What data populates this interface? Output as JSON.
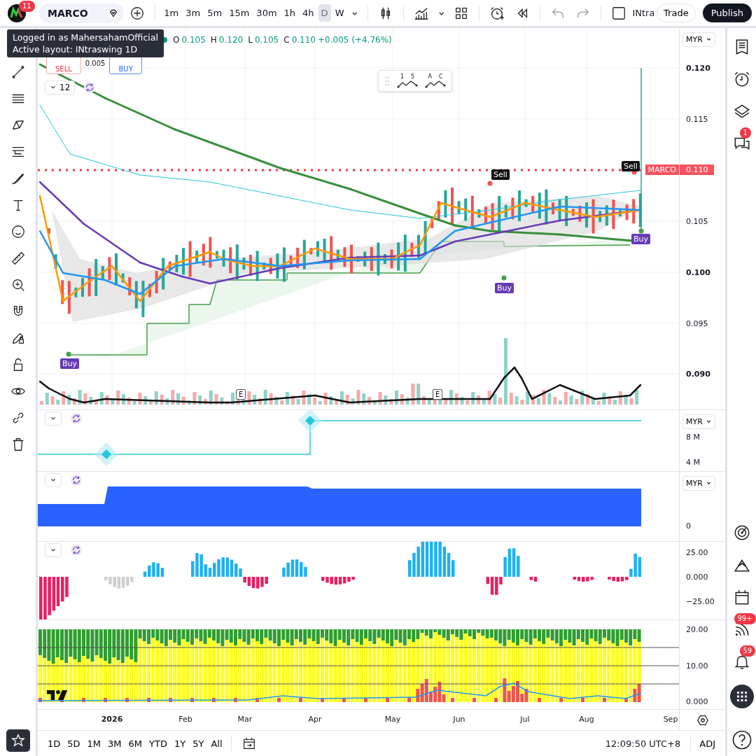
{
  "top_bar": {
    "notification_badge": "11",
    "symbol": "MARCO",
    "intervals": [
      {
        "label": "1m",
        "selected": false
      },
      {
        "label": "3m",
        "selected": false
      },
      {
        "label": "5m",
        "selected": false
      },
      {
        "label": "15m",
        "selected": false
      },
      {
        "label": "30m",
        "selected": false
      },
      {
        "label": "1h",
        "selected": false
      },
      {
        "label": "4h",
        "selected": false
      },
      {
        "label": "D",
        "selected": true
      },
      {
        "label": "W",
        "selected": false
      }
    ],
    "layout_name": "INtra",
    "trade_button": "Trade",
    "publish_button": "Publish"
  },
  "tooltip": {
    "lines": [
      "Logged in as MahersahamOfficial",
      "Active layout: INtraswing 1D"
    ]
  },
  "legend": {
    "values": [
      {
        "label": "O",
        "value": "0.105"
      },
      {
        "label": "H",
        "value": "0.120"
      },
      {
        "label": "L",
        "value": "0.105"
      },
      {
        "label": "C",
        "value": "0.110"
      }
    ],
    "change": "+0.005 (+4.76%)"
  },
  "trade_panel": {
    "sell_label": "SELL",
    "spread": "0.005",
    "buy_label": "BUY"
  },
  "indicator_control": {
    "value": "12"
  },
  "wave_tools": [
    {
      "labels": [
        "1",
        "5"
      ]
    },
    {
      "labels": [
        "A",
        "C"
      ]
    }
  ],
  "signals": [
    {
      "kind": "sell",
      "text": "Sell"
    },
    {
      "kind": "sell",
      "text": "Sell"
    },
    {
      "kind": "buy",
      "text": "Buy"
    },
    {
      "kind": "buy",
      "text": "Buy"
    },
    {
      "kind": "buy",
      "text": "Buy"
    }
  ],
  "earnings_markers": [
    "E",
    "E"
  ],
  "price_tag": {
    "symbol": "MARCO",
    "price": "0.110"
  },
  "price_axis": {
    "currency": "MYR",
    "ticks": [
      {
        "label": "0.120",
        "bold": true
      },
      {
        "label": "0.115",
        "bold": false
      },
      {
        "label": "0.105",
        "bold": false
      },
      {
        "label": "0.100",
        "bold": true
      },
      {
        "label": "0.095",
        "bold": false
      },
      {
        "label": "0.090",
        "bold": true
      }
    ]
  },
  "panes": [
    {
      "currency": "MYR",
      "ticks": [
        {
          "label": "8 M",
          "bold": false
        },
        {
          "label": "4 M",
          "bold": false
        }
      ]
    },
    {
      "currency": "MYR",
      "ticks": [
        {
          "label": "0",
          "bold": false
        }
      ]
    },
    {
      "ticks": [
        {
          "label": "25.00",
          "bold": false
        },
        {
          "label": "0.000",
          "bold": false
        },
        {
          "label": "−25.00",
          "bold": false
        }
      ]
    },
    {
      "ticks": [
        {
          "label": "20.00",
          "bold": false
        },
        {
          "label": "10.00",
          "bold": false
        },
        {
          "label": "0.000",
          "bold": false
        }
      ]
    }
  ],
  "time_axis": [
    {
      "label": "2026",
      "bold": true
    },
    {
      "label": "Feb",
      "bold": false
    },
    {
      "label": "Mar",
      "bold": false
    },
    {
      "label": "Apr",
      "bold": false
    },
    {
      "label": "May",
      "bold": false
    },
    {
      "label": "Jun",
      "bold": false
    },
    {
      "label": "Jul",
      "bold": false
    },
    {
      "label": "Aug",
      "bold": false
    },
    {
      "label": "Sep",
      "bold": false
    }
  ],
  "ranges": [
    "1D",
    "5D",
    "1M",
    "3M",
    "6M",
    "YTD",
    "1Y",
    "5Y",
    "All"
  ],
  "clock": "12:09:50 UTC+8",
  "adjustment": "ADJ",
  "sidebar": {
    "chat_badge": "1",
    "feed_badge": "99+",
    "alerts_badge": "59"
  }
}
